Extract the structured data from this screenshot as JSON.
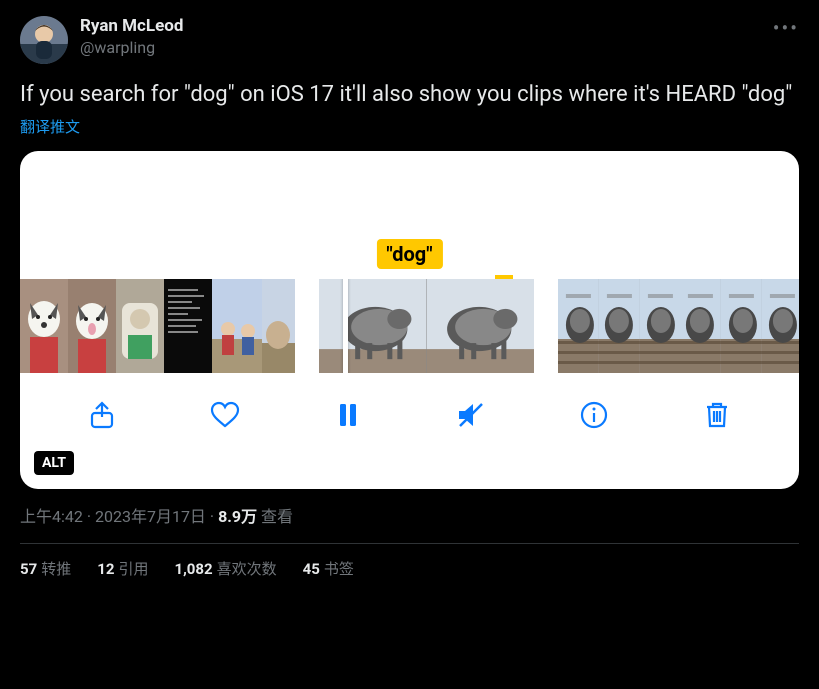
{
  "author": {
    "name": "Ryan McLeod",
    "handle": "@warpling"
  },
  "content": "If you search for \"dog\" on iOS 17 it'll also show you clips where it's HEARD \"dog\"",
  "translate_label": "翻译推文",
  "media": {
    "badge_text": "\"dog\"",
    "alt_label": "ALT",
    "toolbar_icons": [
      "share-icon",
      "heart-icon",
      "pause-icon",
      "mute-icon",
      "info-icon",
      "trash-icon"
    ]
  },
  "meta": {
    "time": "上午4:42",
    "date": "2023年7月17日",
    "views_num": "8.9万",
    "views_label": "查看"
  },
  "stats": {
    "retweets_num": "57",
    "retweets_label": "转推",
    "quotes_num": "12",
    "quotes_label": "引用",
    "likes_num": "1,082",
    "likes_label": "喜欢次数",
    "bookmarks_num": "45",
    "bookmarks_label": "书签"
  }
}
